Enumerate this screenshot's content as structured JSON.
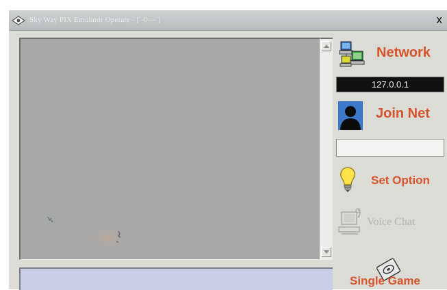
{
  "window": {
    "title": "Sky Way PIX Emulator Operate - [ -0--- ]",
    "close_label": "x"
  },
  "sidebar": {
    "network": {
      "label": "Network",
      "ip": "127.0.0.1",
      "icon": "network-computers-icon"
    },
    "join_net": {
      "label": "Join Net",
      "name_value": "",
      "icon": "user-silhouette-icon"
    },
    "set_option": {
      "label": "Set Option",
      "icon": "lightbulb-icon"
    },
    "voice_chat": {
      "label": "Voice Chat",
      "icon": "computer-voice-icon",
      "enabled": false
    },
    "single_game": {
      "label": "Single Game",
      "icon": "disc-icon"
    }
  },
  "colors": {
    "accent": "#d8522a",
    "disabled": "#b3b3b3",
    "ip_background": "#111111"
  }
}
